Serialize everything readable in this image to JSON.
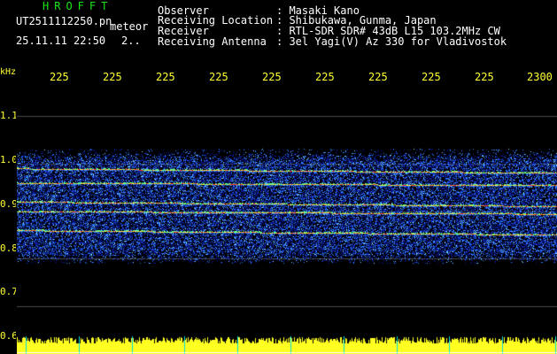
{
  "header": {
    "brand": "HROFFT",
    "filename": "UT2511112250.pn",
    "meteor_label": "meteor",
    "datetime": "25.11.11 22:50",
    "counter": "2..",
    "fields": [
      {
        "label": "Observer",
        "value": ": Masaki Kano"
      },
      {
        "label": "Receiving Location",
        "value": ": Shibukawa, Gunma, Japan"
      },
      {
        "label": "Receiver",
        "value": ": RTL-SDR SDR# 43dB L15 103.2MHz CW"
      },
      {
        "label": "Receiving Antenna",
        "value": ": 3el Yagi(V) Az 330 for Vladivostok"
      }
    ]
  },
  "x_axis": {
    "ticks": [
      "225",
      "225",
      "225",
      "225",
      "225",
      "225",
      "225",
      "225",
      "225",
      "2300"
    ]
  },
  "y_axis": {
    "unit": "kHz",
    "ticks": [
      "1.1",
      "1.0",
      "0.9",
      "0.8",
      "0.7",
      "0.6"
    ]
  },
  "colors": {
    "background": "#000000",
    "label": "#ffff33",
    "brand": "#19e619",
    "signal_low": "#0a1a9a",
    "signal_mid": "#2f7fff",
    "signal_high": "#ffe040",
    "signal_peak": "#ff3a1a",
    "bottom_bar": "#ffff22",
    "grid_line": "#4a4a4a",
    "marker": "#00dddd"
  },
  "spectrogram": {
    "kHz_top": 1.16,
    "kHz_bottom": 0.6,
    "band_kHz_range": [
      0.79,
      1.03
    ],
    "signal_lines_kHz": [
      0.99,
      0.96,
      0.92,
      0.9,
      0.86
    ],
    "minute_markers": 10
  }
}
